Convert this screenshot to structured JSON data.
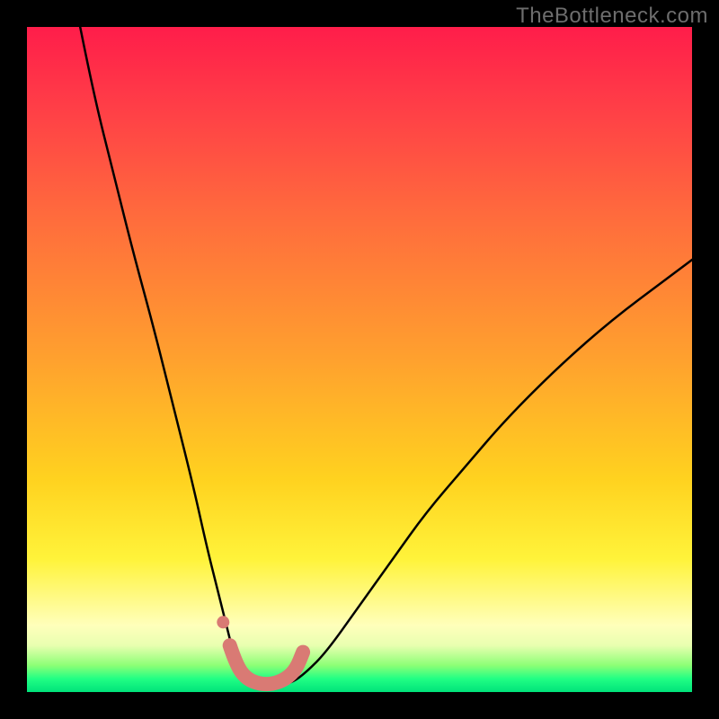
{
  "watermark": "TheBottleneck.com",
  "gradient_colors": {
    "top": "#ff1d4a",
    "mid_orange": "#ffa12e",
    "mid_yellow": "#fff33a",
    "bottom": "#00e27a"
  },
  "chart_data": {
    "type": "line",
    "title": "",
    "xlabel": "",
    "ylabel": "",
    "xlim": [
      0,
      100
    ],
    "ylim": [
      0,
      100
    ],
    "series": [
      {
        "name": "bottleneck-curve",
        "comment": "Black V-shaped curve; x and y are percentages of the plot area (0,0 = bottom-left). Values estimated from pixel positions.",
        "x": [
          8,
          10,
          13,
          16,
          19,
          22,
          25,
          27,
          28.5,
          30,
          31,
          32.5,
          34,
          36,
          38,
          40,
          42,
          45,
          50,
          55,
          60,
          66,
          72,
          80,
          88,
          96,
          100
        ],
        "y": [
          100,
          90,
          78,
          66,
          55,
          43,
          31,
          22,
          16,
          10,
          6,
          3,
          1.5,
          1,
          1,
          1.5,
          3,
          6,
          13,
          20,
          27,
          34,
          41,
          49,
          56,
          62,
          65
        ]
      },
      {
        "name": "highlight-trough",
        "comment": "Salmon-colored thick stroke + dot marking the trough region near the bottom.",
        "stroke": "#d97a74",
        "x": [
          30.5,
          31.5,
          33,
          35,
          37,
          39,
          40.5,
          41.5
        ],
        "y": [
          7,
          4,
          2,
          1.2,
          1.2,
          2,
          3.5,
          6
        ]
      },
      {
        "name": "highlight-dot",
        "comment": "Single salmon dot just above the left side of the trough.",
        "stroke": "#d97a74",
        "x": [
          29.5
        ],
        "y": [
          10.5
        ]
      }
    ]
  }
}
